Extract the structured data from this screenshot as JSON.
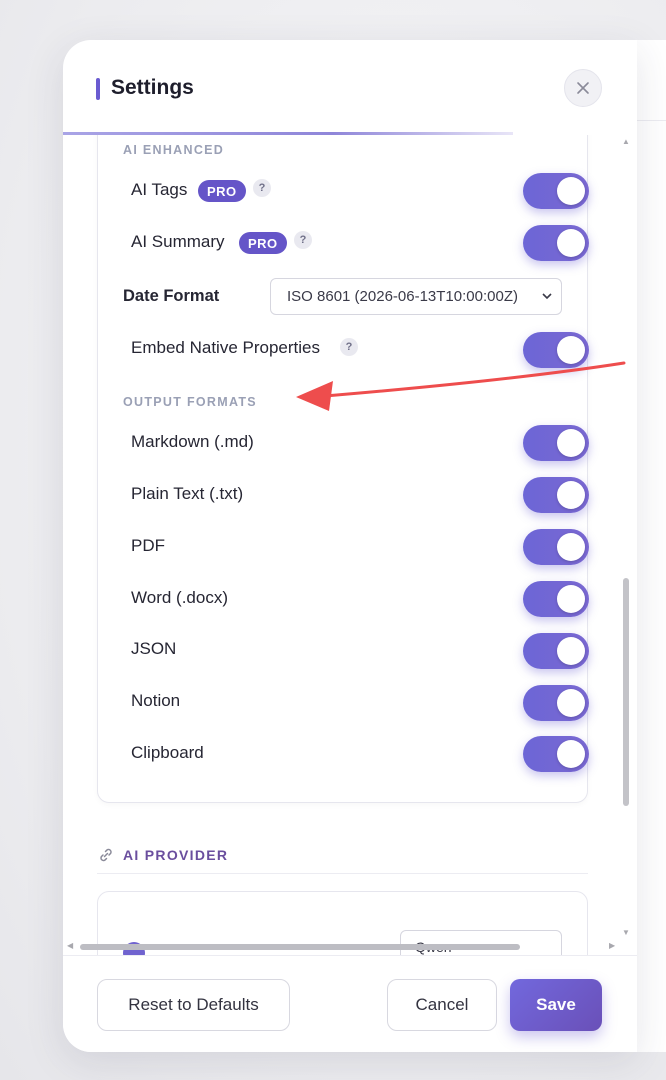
{
  "dialog": {
    "title": "Settings"
  },
  "sections": {
    "ai_enhanced": {
      "label": "AI ENHANCED",
      "ai_tags": {
        "label": "AI Tags",
        "badge": "PRO",
        "help": "?",
        "enabled": true
      },
      "ai_summary": {
        "label": "AI Summary",
        "badge": "PRO",
        "help": "?",
        "enabled": true
      },
      "date_format": {
        "label": "Date Format",
        "value": "ISO 8601 (2026-06-13T10:00:00Z)"
      },
      "embed_native": {
        "label": "Embed Native Properties",
        "help": "?",
        "enabled": true
      }
    },
    "output_formats": {
      "label": "OUTPUT FORMATS",
      "items": [
        {
          "label": "Markdown (.md)",
          "enabled": true
        },
        {
          "label": "Plain Text (.txt)",
          "enabled": true
        },
        {
          "label": "PDF",
          "enabled": true
        },
        {
          "label": "Word (.docx)",
          "enabled": true
        },
        {
          "label": "JSON",
          "enabled": true
        },
        {
          "label": "Notion",
          "enabled": true
        },
        {
          "label": "Clipboard",
          "enabled": true
        }
      ]
    },
    "ai_provider": {
      "label": "AI PROVIDER",
      "selected": "Qwen"
    }
  },
  "footer": {
    "reset_label": "Reset to Defaults",
    "cancel_label": "Cancel",
    "save_label": "Save"
  },
  "icons": {
    "close": "close-icon",
    "link": "link-icon",
    "chevron": "chevron-down-icon",
    "annotation": "red-arrow"
  },
  "colors": {
    "accent": "#6c66d6",
    "pro_badge": "#6555c8",
    "provider_heading": "#6a4e9e",
    "annotation": "#ee4d4d"
  }
}
